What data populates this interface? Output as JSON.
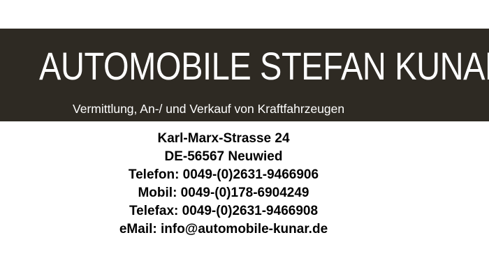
{
  "header": {
    "title": "AUTOMOBILE STEFAN KUNAR",
    "subtitle": "Vermittlung, An-/ und Verkauf von Kraftfahrzeugen"
  },
  "contact": {
    "street": "Karl-Marx-Strasse 24",
    "city": "DE-56567 Neuwied",
    "phone": "Telefon: 0049-(0)2631-9466906",
    "mobile": "Mobil: 0049-(0)178-6904249",
    "fax": "Telefax: 0049-(0)2631-9466908",
    "email": "eMail: info@automobile-kunar.de"
  },
  "colors": {
    "banner_background": "#2e2a23",
    "banner_text": "#ffffff",
    "body_text": "#000000"
  }
}
